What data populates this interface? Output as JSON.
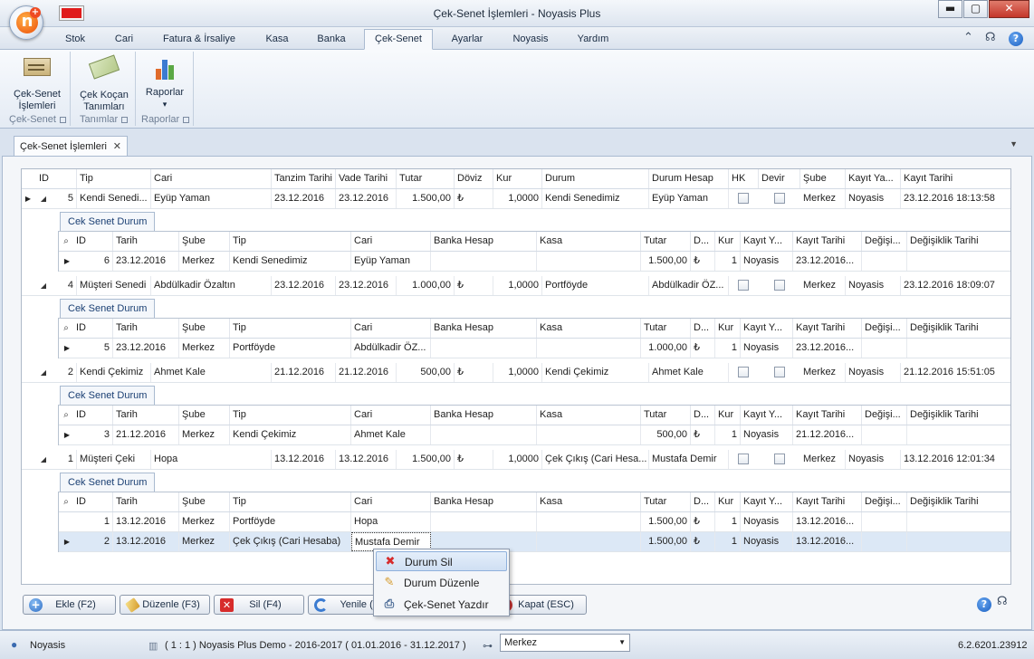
{
  "window": {
    "title": "Çek-Senet İşlemleri - Noyasis Plus",
    "min": "▬",
    "max": "▢",
    "close": "✕",
    "logo_letter": "n",
    "logo_plus": "+"
  },
  "menu_tabs": [
    "Stok",
    "Cari",
    "Fatura & İrsaliye",
    "Kasa",
    "Banka",
    "Çek-Senet",
    "Ayarlar",
    "Noyasis",
    "Yardım"
  ],
  "active_tab": "Çek-Senet",
  "ribbon": {
    "groups": [
      {
        "button": "Çek-Senet İşlemleri",
        "label": "Çek-Senet",
        "icon": "check-icon"
      },
      {
        "button": "Çek Koçan Tanımları",
        "label": "Tanımlar",
        "icon": "money-icon"
      },
      {
        "button": "Raporlar",
        "dropdown": "▾",
        "label": "Raporlar",
        "icon": "bar-chart-icon"
      }
    ]
  },
  "document_tab": {
    "label": "Çek-Senet İşlemleri",
    "close": "✕"
  },
  "grid": {
    "columns": [
      "ID",
      "Tip",
      "Cari",
      "Tanzim Tarihi",
      "Vade Tarihi",
      "Tutar",
      "Döviz",
      "Kur",
      "Durum",
      "Durum Hesap",
      "HK",
      "Devir",
      "Şube",
      "Kayıt Ya...",
      "Kayıt Tarihi"
    ],
    "detail_tab_label": "Cek Senet Durum",
    "detail_columns": [
      "ID",
      "Tarih",
      "Şube",
      "Tip",
      "Cari",
      "Banka Hesap",
      "Kasa",
      "Tutar",
      "D...",
      "Kur",
      "Kayıt Y...",
      "Kayıt Tarihi",
      "Değişi...",
      "Değişiklik Tarihi"
    ],
    "rows": [
      {
        "id": "5",
        "tip": "Kendi Senedi...",
        "cari": "Eyüp Yaman",
        "tanzim": "23.12.2016",
        "vade": "23.12.2016",
        "tutar": "1.500,00",
        "doviz": "₺",
        "kur": "1,0000",
        "durum": "Kendi Senedimiz",
        "durum_hesap": "Eyüp Yaman",
        "sube": "Merkez",
        "kayit_yapan": "Noyasis",
        "kayit_tarihi": "23.12.2016 18:13:58",
        "details": [
          {
            "id": "6",
            "tarih": "23.12.2016",
            "sube": "Merkez",
            "tip": "Kendi Senedimiz",
            "cari": "Eyüp Yaman",
            "banka": "",
            "kasa": "",
            "tutar": "1.500,00",
            "d": "₺",
            "kur": "1",
            "kayit_yapan": "Noyasis",
            "kayit_tarihi": "23.12.2016...",
            "degisen": "",
            "degisiklik_tarihi": ""
          }
        ]
      },
      {
        "id": "4",
        "tip": "Müşteri Senedi",
        "cari": "Abdülkadir Özaltın",
        "tanzim": "23.12.2016",
        "vade": "23.12.2016",
        "tutar": "1.000,00",
        "doviz": "₺",
        "kur": "1,0000",
        "durum": "Portföyde",
        "durum_hesap": "Abdülkadir ÖZ...",
        "sube": "Merkez",
        "kayit_yapan": "Noyasis",
        "kayit_tarihi": "23.12.2016 18:09:07",
        "details": [
          {
            "id": "5",
            "tarih": "23.12.2016",
            "sube": "Merkez",
            "tip": "Portföyde",
            "cari": "Abdülkadir ÖZ...",
            "banka": "",
            "kasa": "",
            "tutar": "1.000,00",
            "d": "₺",
            "kur": "1",
            "kayit_yapan": "Noyasis",
            "kayit_tarihi": "23.12.2016...",
            "degisen": "",
            "degisiklik_tarihi": ""
          }
        ]
      },
      {
        "id": "2",
        "tip": "Kendi Çekimiz",
        "cari": "Ahmet Kale",
        "tanzim": "21.12.2016",
        "vade": "21.12.2016",
        "tutar": "500,00",
        "doviz": "₺",
        "kur": "1,0000",
        "durum": "Kendi Çekimiz",
        "durum_hesap": "Ahmet Kale",
        "sube": "Merkez",
        "kayit_yapan": "Noyasis",
        "kayit_tarihi": "21.12.2016 15:51:05",
        "details": [
          {
            "id": "3",
            "tarih": "21.12.2016",
            "sube": "Merkez",
            "tip": "Kendi Çekimiz",
            "cari": "Ahmet Kale",
            "banka": "",
            "kasa": "",
            "tutar": "500,00",
            "d": "₺",
            "kur": "1",
            "kayit_yapan": "Noyasis",
            "kayit_tarihi": "21.12.2016...",
            "degisen": "",
            "degisiklik_tarihi": ""
          }
        ]
      },
      {
        "id": "1",
        "tip": "Müşteri Çeki",
        "cari": "Hopa",
        "tanzim": "13.12.2016",
        "vade": "13.12.2016",
        "tutar": "1.500,00",
        "doviz": "₺",
        "kur": "1,0000",
        "durum": "Çek Çıkış (Cari Hesa...",
        "durum_hesap": "Mustafa Demir",
        "sube": "Merkez",
        "kayit_yapan": "Noyasis",
        "kayit_tarihi": "13.12.2016 12:01:34",
        "details": [
          {
            "id": "1",
            "tarih": "13.12.2016",
            "sube": "Merkez",
            "tip": "Portföyde",
            "cari": "Hopa",
            "banka": "",
            "kasa": "",
            "tutar": "1.500,00",
            "d": "₺",
            "kur": "1",
            "kayit_yapan": "Noyasis",
            "kayit_tarihi": "13.12.2016...",
            "degisen": "",
            "degisiklik_tarihi": ""
          },
          {
            "id": "2",
            "tarih": "13.12.2016",
            "sube": "Merkez",
            "tip": "Çek Çıkış (Cari Hesaba)",
            "cari": "Mustafa Demir",
            "banka": "",
            "kasa": "",
            "tutar": "1.500,00",
            "d": "₺",
            "kur": "1",
            "kayit_yapan": "Noyasis",
            "kayit_tarihi": "13.12.2016...",
            "degisen": "",
            "degisiklik_tarihi": ""
          }
        ]
      }
    ]
  },
  "buttons": {
    "ekle": "Ekle (F2)",
    "duzenle": "Düzenle (F3)",
    "sil": "Sil (F4)",
    "yenile": "Yenile (F",
    "kapat": "Kapat (ESC)"
  },
  "context_menu": {
    "items": [
      "Durum Sil",
      "Durum Düzenle",
      "Çek-Senet Yazdır"
    ],
    "highlighted": "Durum Sil"
  },
  "statusbar": {
    "user": "Noyasis",
    "company": "( 1 : 1 )  Noyasis Plus Demo - 2016-2017  ( 01.01.2016 - 31.12.2017 )",
    "branch": "Merkez",
    "version": "6.2.6201.23912"
  },
  "colors": {
    "accent": "#1a3f73",
    "close_button": "#c4362a",
    "flag": "#e01b1b",
    "selection": "#dce8f6"
  }
}
